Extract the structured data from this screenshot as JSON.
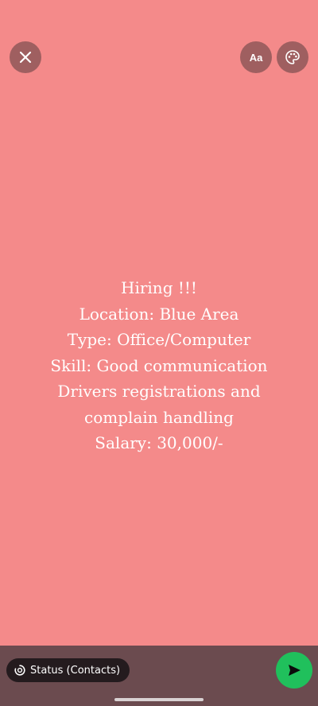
{
  "colors": {
    "background": "#f48a8a",
    "bottom_bar": "#6b4b4f",
    "send_button": "#20c05c",
    "text": "#ffffff"
  },
  "toolbar": {
    "close_icon": "close-icon",
    "text_style_label": "Aa",
    "palette_icon": "palette-icon"
  },
  "status": {
    "lines": [
      "Hiring !!!",
      "Location: Blue Area",
      "Type: Office/Computer",
      "Skill: Good communication",
      "Drivers registrations and",
      "complain handling",
      "Salary: 30,000/-"
    ]
  },
  "footer": {
    "audience_label": "Status (Contacts)",
    "audience_icon": "status-ring-icon",
    "send_icon": "send-icon"
  }
}
